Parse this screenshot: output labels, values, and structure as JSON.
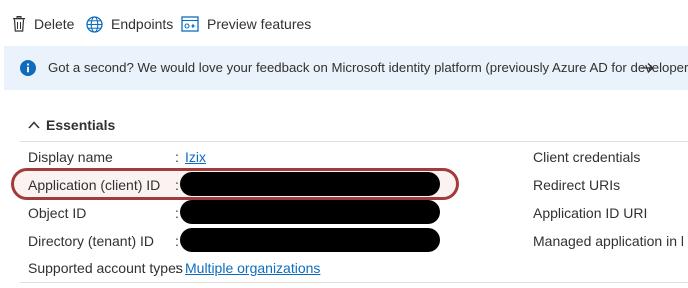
{
  "toolbar": {
    "delete_label": "Delete",
    "endpoints_label": "Endpoints",
    "preview_label": "Preview features"
  },
  "banner": {
    "message": "Got a second? We would love your feedback on Microsoft identity platform (previously Azure AD for developer).",
    "arrow": "→"
  },
  "essentials": {
    "title": "Essentials",
    "rows": [
      {
        "label": "Display name",
        "value": "Izix",
        "value_type": "link"
      },
      {
        "label": "Application (client) ID",
        "value": "",
        "value_type": "redacted"
      },
      {
        "label": "Object ID",
        "value": "",
        "value_type": "redacted"
      },
      {
        "label": "Directory (tenant) ID",
        "value": "",
        "value_type": "redacted"
      },
      {
        "label": "Supported account types",
        "value": "Multiple organizations",
        "value_type": "link"
      }
    ],
    "right_links": [
      "Client credentials",
      "Redirect URIs",
      "Application ID URI",
      "Managed application in l..."
    ],
    "separator": ":"
  },
  "colors": {
    "accent_link": "#0f6cbd",
    "banner_bg": "#eaf2fb",
    "highlight_ring": "#a33b3a",
    "redaction": "#000000"
  },
  "icons": [
    "trash-icon",
    "globe-icon",
    "preview-features-icon",
    "info-icon",
    "arrow-right-icon",
    "chevron-up-icon"
  ]
}
